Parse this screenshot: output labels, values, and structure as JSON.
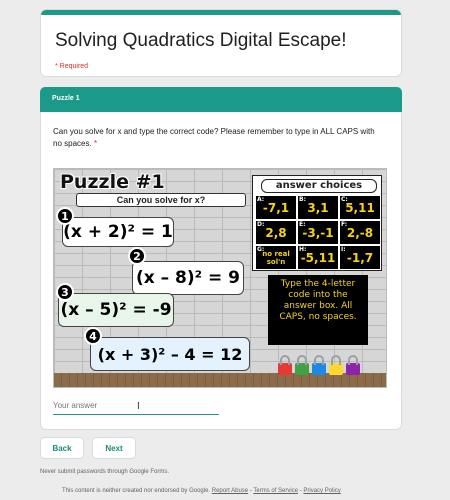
{
  "form": {
    "title": "Solving Quadratics Digital Escape!",
    "required_note": "* Required"
  },
  "section": {
    "title": "Puzzle 1"
  },
  "question": {
    "text": "Can you solve for x and type the correct code? Please remember to type in ALL CAPS with no spaces.",
    "required_marker": "*"
  },
  "puzzle_image": {
    "title": "Puzzle #1",
    "subtitle": "Can you solve for x?",
    "equations": [
      {
        "number": "1",
        "text": "(x + 2)² = 1"
      },
      {
        "number": "2",
        "text": "(x – 8)² = 9"
      },
      {
        "number": "3",
        "text": "(x – 5)² = -9"
      },
      {
        "number": "4",
        "text": "(x + 3)² – 4 = 12"
      }
    ],
    "answer_choices_title": "answer choices",
    "choices": [
      {
        "letter": "A:",
        "value": "-7,1"
      },
      {
        "letter": "B:",
        "value": "3,1"
      },
      {
        "letter": "C:",
        "value": "5,11"
      },
      {
        "letter": "D:",
        "value": "2,8"
      },
      {
        "letter": "E:",
        "value": "-3,-1"
      },
      {
        "letter": "F:",
        "value": "2,-8"
      },
      {
        "letter": "G:",
        "value": "no real sol'n"
      },
      {
        "letter": "H:",
        "value": "-5,11"
      },
      {
        "letter": "I:",
        "value": "-1,7"
      }
    ],
    "instructions": "Type the 4-letter code into the answer box. All CAPS, no spaces.",
    "lock_colors": [
      "#e53935",
      "#43a047",
      "#1e88e5",
      "#fdd835",
      "#8e24aa"
    ],
    "equation_card_colors": [
      "#ffffff",
      "#ffffff",
      "#e8f5e9",
      "#e3f2fd"
    ]
  },
  "answer_field": {
    "placeholder": "Your answer"
  },
  "nav": {
    "back_label": "Back",
    "next_label": "Next"
  },
  "warning": "Never submit passwords through Google Forms.",
  "footer": {
    "text": "This content is neither created nor endorsed by Google.",
    "report_abuse": "Report Abuse",
    "sep1": " - ",
    "terms": "Terms of Service",
    "sep2": " - ",
    "privacy": "Privacy Policy"
  },
  "colors": {
    "accent": "#1b9a8a",
    "required": "#d93025"
  }
}
